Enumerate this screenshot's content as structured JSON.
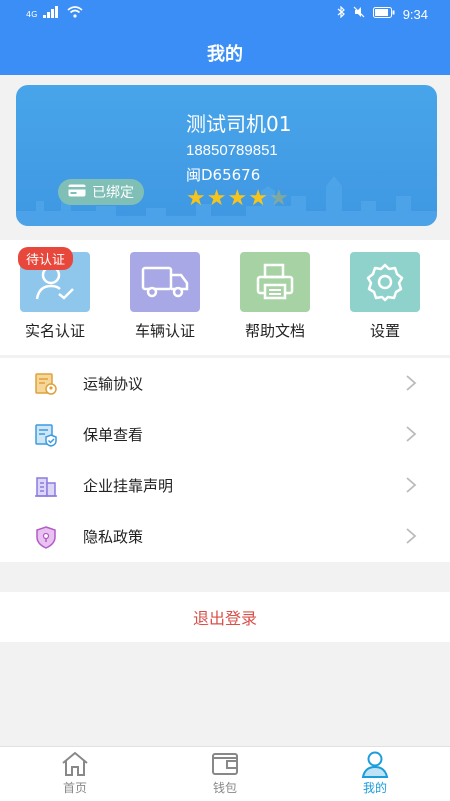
{
  "status_bar": {
    "time": "9:34",
    "network": "4G"
  },
  "header": {
    "title": "我的"
  },
  "profile": {
    "name": "测试司机01",
    "phone": "18850789851",
    "plate": "闽D65676",
    "rating": 4,
    "rating_max": 5,
    "bound_label": "已绑定"
  },
  "quick_actions": [
    {
      "label": "实名认证",
      "icon": "user-check-icon",
      "badge": "待认证",
      "color": "#8fc6ec"
    },
    {
      "label": "车辆认证",
      "icon": "truck-icon",
      "color": "#a9a8e6"
    },
    {
      "label": "帮助文档",
      "icon": "printer-doc-icon",
      "color": "#a7d3a4"
    },
    {
      "label": "设置",
      "icon": "gear-icon",
      "color": "#8fd2cb"
    }
  ],
  "menu": [
    {
      "label": "运输协议",
      "icon": "contract-icon"
    },
    {
      "label": "保单查看",
      "icon": "policy-icon"
    },
    {
      "label": "企业挂靠声明",
      "icon": "building-icon"
    },
    {
      "label": "隐私政策",
      "icon": "shield-icon"
    }
  ],
  "logout_label": "退出登录",
  "bottom_nav": [
    {
      "label": "首页",
      "icon": "home-icon",
      "active": false
    },
    {
      "label": "钱包",
      "icon": "wallet-icon",
      "active": false
    },
    {
      "label": "我的",
      "icon": "person-icon",
      "active": true
    }
  ]
}
